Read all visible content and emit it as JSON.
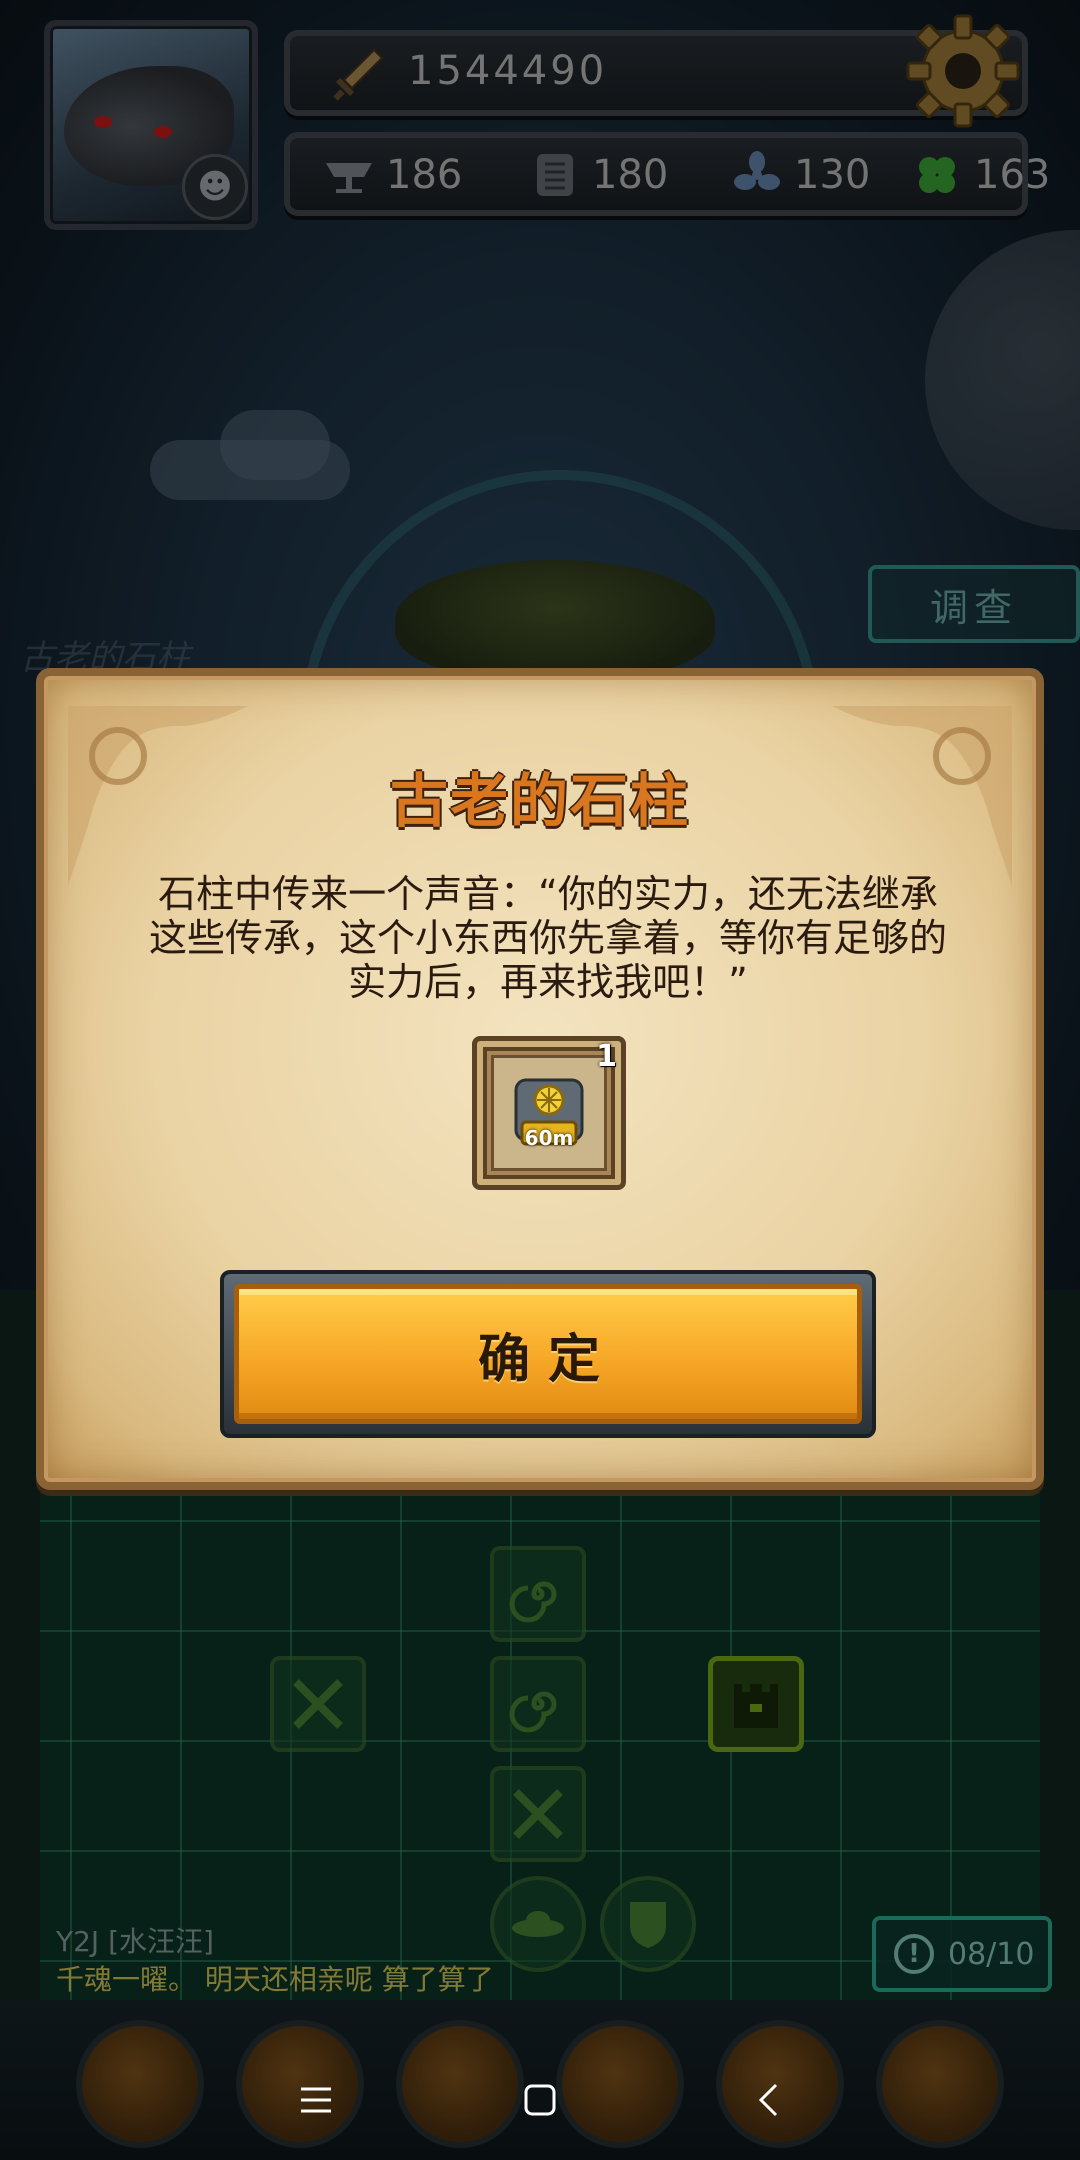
{
  "hud": {
    "power": "1544490",
    "resources": [
      {
        "icon": "anvil-icon",
        "value": "186"
      },
      {
        "icon": "scroll-icon",
        "value": "180"
      },
      {
        "icon": "propeller-icon",
        "value": "130"
      },
      {
        "icon": "clover-icon",
        "value": "163"
      }
    ]
  },
  "scene": {
    "investigate_label": "调查",
    "ghost_title": "古老的石柱"
  },
  "dialog": {
    "title": "古老的石柱",
    "body": "石柱中传来一个声音：“你的实力，还无法继承这些传承，这个小东西你先拿着，等你有足够的实力后，再来找我吧！”",
    "reward": {
      "icon": "speedup-chest-icon",
      "label": "60m",
      "quantity": "1"
    },
    "confirm_label": "确定"
  },
  "chat": {
    "meta": "Y2J [水汪汪]",
    "message": "千魂一曜。 明天还相亲呢 算了算了"
  },
  "counter": {
    "value": "08/10"
  },
  "colors": {
    "title_orange": "#d8771f",
    "confirm_gold": "#f7a726",
    "grid_green": "#0f3a2a",
    "parchment": "#ead3a4"
  }
}
